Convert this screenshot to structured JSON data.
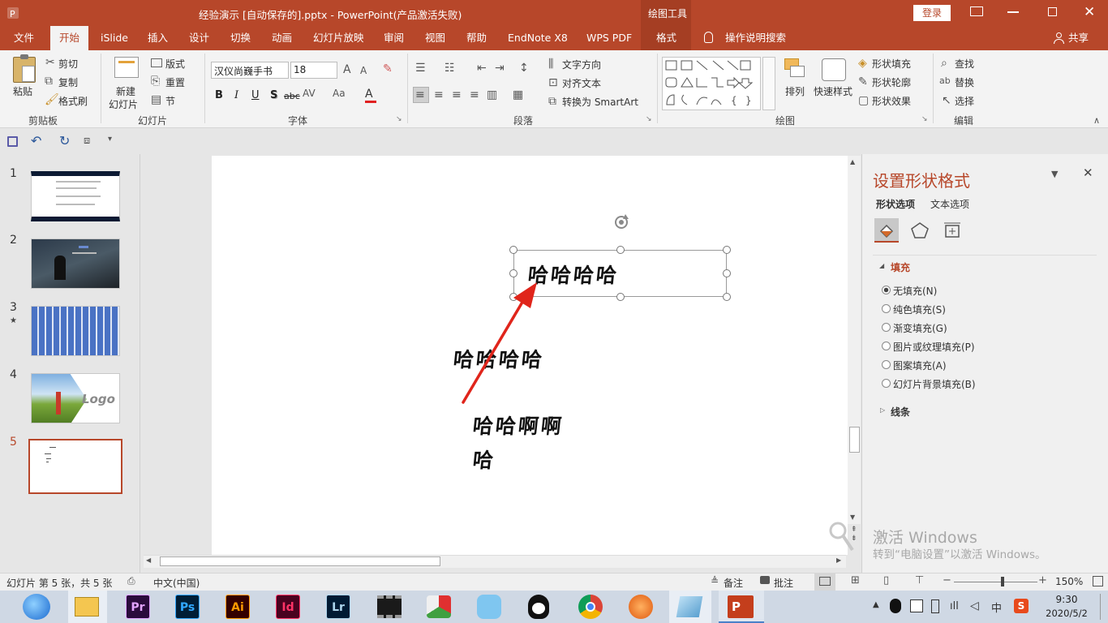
{
  "window": {
    "title": "经验演示 [自动保存的].pptx  -  PowerPoint(产品激活失败)",
    "contextual_tab_group": "绘图工具",
    "login_button": "登录",
    "share_label": "共享"
  },
  "tabs": [
    "文件",
    "开始",
    "iSlide",
    "插入",
    "设计",
    "切换",
    "动画",
    "幻灯片放映",
    "审阅",
    "视图",
    "帮助",
    "EndNote X8",
    "WPS PDF",
    "格式"
  ],
  "active_tab": "开始",
  "tell_me": "操作说明搜索",
  "ribbon": {
    "clipboard": {
      "paste": "粘贴",
      "cut": "剪切",
      "copy": "复制",
      "format_painter": "格式刷",
      "group": "剪贴板"
    },
    "slides": {
      "new_slide_1": "新建",
      "new_slide_2": "幻灯片",
      "layout": "版式",
      "reset": "重置",
      "section": "节",
      "group": "幻灯片"
    },
    "font": {
      "font_name": "汉仪尚巍手书",
      "font_size": "18",
      "bold": "B",
      "italic": "I",
      "underline": "U",
      "shadow": "S",
      "strike": "abc",
      "group": "字体"
    },
    "paragraph": {
      "text_direction": "文字方向",
      "align_text": "对齐文本",
      "smartart": "转换为 SmartArt",
      "group": "段落"
    },
    "drawing": {
      "arrange": "排列",
      "quick_styles": "快速样式",
      "shape_fill": "形状填充",
      "shape_outline": "形状轮廓",
      "shape_effects": "形状效果",
      "group": "绘图"
    },
    "editing": {
      "find": "查找",
      "replace": "替换",
      "select": "选择",
      "group": "编辑"
    }
  },
  "slides_panel": {
    "numbers": [
      "1",
      "2",
      "3",
      "4",
      "5"
    ],
    "slide3_star": "★",
    "slide4_logo": "Logo",
    "active_slide": 5
  },
  "slide": {
    "textbox_selected": "哈哈哈哈",
    "text2": "哈哈哈哈",
    "text3_line1": "哈哈啊啊",
    "text3_line2": "哈"
  },
  "format_pane": {
    "title": "设置形状格式",
    "tab_shape": "形状选项",
    "tab_text": "文本选项",
    "fill_section": "填充",
    "fill_options": [
      "无填充(N)",
      "纯色填充(S)",
      "渐变填充(G)",
      "图片或纹理填充(P)",
      "图案填充(A)",
      "幻灯片背景填充(B)"
    ],
    "selected_fill_index": 0,
    "line_section": "线条"
  },
  "watermark": {
    "line1": "激活 Windows",
    "line2": "转到“电脑设置”以激活 Windows。"
  },
  "statusbar": {
    "slide_info": "幻灯片 第 5 张，共 5 张",
    "language": "中文(中国)",
    "notes": "备注",
    "comments": "批注",
    "zoom_level": "150%",
    "zoom_fraction": 0.58
  },
  "taskbar": {
    "apps": [
      "Pr",
      "Ps",
      "Ai",
      "Id",
      "Lr"
    ],
    "time": "9:30",
    "date": "2020/5/2",
    "ime": "中"
  },
  "colors": {
    "accent": "#b7472a",
    "arrow": "#e0251b"
  }
}
